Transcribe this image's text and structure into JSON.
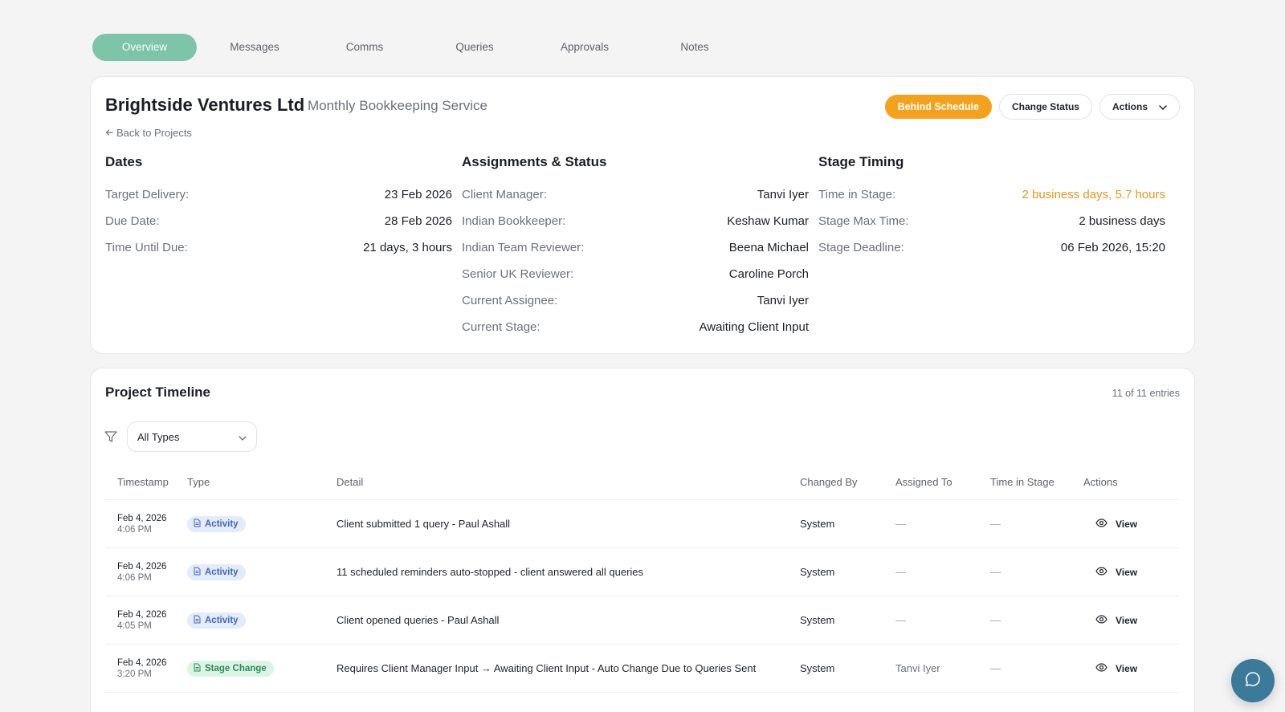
{
  "tabs": [
    {
      "label": "Overview",
      "active": true
    },
    {
      "label": "Messages"
    },
    {
      "label": "Comms"
    },
    {
      "label": "Queries"
    },
    {
      "label": "Approvals"
    },
    {
      "label": "Notes"
    }
  ],
  "project": {
    "name": "Brightside Ventures Ltd",
    "service": "Monthly Bookkeeping Service",
    "back_label": "Back to Projects",
    "status_badge": "Behind Schedule",
    "change_status_label": "Change Status",
    "actions_label": "Actions"
  },
  "dates": {
    "title": "Dates",
    "rows": [
      {
        "label": "Target Delivery:",
        "value": "23 Feb 2026"
      },
      {
        "label": "Due Date:",
        "value": "28 Feb 2026"
      },
      {
        "label": "Time Until Due:",
        "value": "21 days, 3 hours"
      }
    ]
  },
  "assignments": {
    "title": "Assignments & Status",
    "rows": [
      {
        "label": "Client Manager:",
        "value": "Tanvi Iyer"
      },
      {
        "label": "Indian Bookkeeper:",
        "value": "Keshaw Kumar"
      },
      {
        "label": "Indian Team Reviewer:",
        "value": "Beena Michael"
      },
      {
        "label": "Senior UK Reviewer:",
        "value": "Caroline Porch"
      },
      {
        "label": "Current Assignee:",
        "value": "Tanvi Iyer"
      },
      {
        "label": "Current Stage:",
        "value": "Awaiting Client Input"
      }
    ]
  },
  "stage_timing": {
    "title": "Stage Timing",
    "rows": [
      {
        "label": "Time in Stage:",
        "value": "2 business days, 5.7 hours"
      },
      {
        "label": "Stage Max Time:",
        "value": "2 business days"
      },
      {
        "label": "Stage Deadline:",
        "value": "06 Feb 2026, 15:20"
      }
    ]
  },
  "timeline": {
    "title": "Project Timeline",
    "count": "11 of 11 entries",
    "filter_value": "All Types",
    "columns": [
      "Timestamp",
      "Type",
      "Detail",
      "Changed By",
      "Assigned To",
      "Time in Stage",
      "Actions"
    ],
    "rows": [
      {
        "date": "Feb 4, 2026",
        "time": "4:06 PM",
        "type": "Activity",
        "detail": "Client submitted 1 query - Paul Ashall",
        "by": "System",
        "to": "—",
        "stage_time": "—",
        "action": "View"
      },
      {
        "date": "Feb 4, 2026",
        "time": "4:06 PM",
        "type": "Activity",
        "detail": "11 scheduled reminders auto-stopped - client answered all queries",
        "by": "System",
        "to": "—",
        "stage_time": "—",
        "action": "View"
      },
      {
        "date": "Feb 4, 2026",
        "time": "4:05 PM",
        "type": "Activity",
        "detail": "Client opened queries - Paul Ashall",
        "by": "System",
        "to": "—",
        "stage_time": "—",
        "action": "View"
      },
      {
        "date": "Feb 4, 2026",
        "time": "3:20 PM",
        "type": "Stage Change",
        "detail": "Requires Client Manager Input → Awaiting Client Input - Auto Change Due to Queries Sent",
        "by": "System",
        "to": "Tanvi Iyer",
        "stage_time": "—",
        "action": "View"
      }
    ]
  },
  "colors": {
    "accent": "#7dc4a8",
    "warning": "#f4a21b",
    "activity_badge": "#3f66c2",
    "stage_badge": "#2b8a57"
  },
  "icons": {
    "back": "arrow-left-icon",
    "dropdown": "chevron-down-icon",
    "filter": "filter-icon",
    "doc": "document-icon",
    "view": "eye-icon",
    "chat": "chat-bubble-icon"
  }
}
